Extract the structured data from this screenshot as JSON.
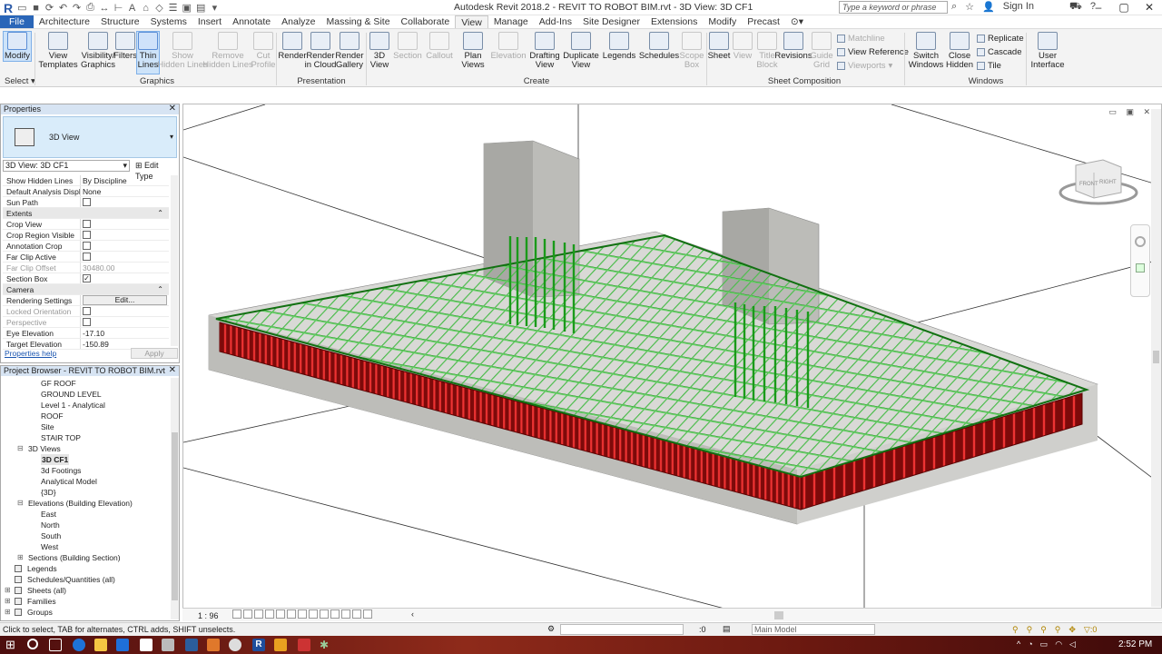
{
  "titlebar": {
    "logo": "R",
    "title": "Autodesk Revit 2018.2 -    REVIT TO ROBOT BIM.rvt - 3D View: 3D CF1",
    "search_placeholder": "Type a keyword or phrase",
    "sign_in": "Sign In"
  },
  "tabs": [
    "File",
    "Architecture",
    "Structure",
    "Systems",
    "Insert",
    "Annotate",
    "Analyze",
    "Massing & Site",
    "Collaborate",
    "View",
    "Manage",
    "Add-Ins",
    "Site Designer",
    "Extensions",
    "Modify",
    "Precast"
  ],
  "active_tab": "View",
  "ribbon": {
    "modify": "Modify",
    "select": "Select",
    "graphics": [
      "View\nTemplates",
      "Visibility/\nGraphics",
      "Filters",
      "Thin\nLines",
      "Show\nHidden Lines",
      "Remove\nHidden Lines",
      "Cut\nProfile"
    ],
    "graphics_label": "Graphics",
    "presentation": [
      "Render",
      "Render\nin Cloud",
      "Render\nGallery"
    ],
    "presentation_label": "Presentation",
    "create": [
      "3D\nView",
      "Section",
      "Callout",
      "Plan\nViews",
      "Elevation",
      "Drafting\nView",
      "Duplicate\nView",
      "Legends",
      "Schedules",
      "Scope\nBox"
    ],
    "create_label": "Create",
    "sheet": [
      "Sheet",
      "View",
      "Title\nBlock",
      "Revisions",
      "Guide\nGrid"
    ],
    "sheet_small": [
      "Matchline",
      "View Reference",
      "Viewports"
    ],
    "sheet_label": "Sheet Composition",
    "windows": [
      "Switch\nWindows",
      "Close\nHidden"
    ],
    "windows_small": [
      "Replicate",
      "Cascade",
      "Tile"
    ],
    "windows_label": "Windows",
    "user_interface": "User\nInterface"
  },
  "properties": {
    "title": "Properties",
    "type_name": "3D View",
    "instance": "3D View: 3D CF1",
    "edit_type": "Edit Type",
    "rows": [
      {
        "k": "Show Hidden Lines",
        "v": "By Discipline"
      },
      {
        "k": "Default Analysis Displ...",
        "v": "None"
      },
      {
        "k": "Sun Path",
        "chk": false
      },
      {
        "section": "Extents"
      },
      {
        "k": "Crop View",
        "chk": false
      },
      {
        "k": "Crop Region Visible",
        "chk": false
      },
      {
        "k": "Annotation Crop",
        "chk": false
      },
      {
        "k": "Far Clip Active",
        "chk": false
      },
      {
        "k": "Far Clip Offset",
        "v": "30480.00",
        "dis": true
      },
      {
        "k": "Section Box",
        "chk": true
      },
      {
        "section": "Camera"
      },
      {
        "k": "Rendering Settings",
        "btn": "Edit..."
      },
      {
        "k": "Locked Orientation",
        "chk": false,
        "dis": true
      },
      {
        "k": "Perspective",
        "chk": false,
        "dis": true
      },
      {
        "k": "Eye Elevation",
        "v": "-17.10"
      },
      {
        "k": "Target Elevation",
        "v": "-150.89"
      }
    ],
    "help": "Properties help",
    "apply": "Apply"
  },
  "browser": {
    "title": "Project Browser - REVIT TO ROBOT BIM.rvt",
    "nodes": [
      {
        "t": "GF ROOF",
        "l": 3
      },
      {
        "t": "GROUND LEVEL",
        "l": 3
      },
      {
        "t": "Level 1 - Analytical",
        "l": 3
      },
      {
        "t": "ROOF",
        "l": 3
      },
      {
        "t": "Site",
        "l": 3
      },
      {
        "t": "STAIR TOP",
        "l": 3
      },
      {
        "t": "3D Views",
        "l": 1,
        "tg": "⊟"
      },
      {
        "t": "3D CF1",
        "l": 3,
        "b": true
      },
      {
        "t": "3d Footings",
        "l": 3
      },
      {
        "t": "Analytical Model",
        "l": 3
      },
      {
        "t": "{3D}",
        "l": 3
      },
      {
        "t": "Elevations (Building Elevation)",
        "l": 1,
        "tg": "⊟"
      },
      {
        "t": "East",
        "l": 3
      },
      {
        "t": "North",
        "l": 3
      },
      {
        "t": "South",
        "l": 3
      },
      {
        "t": "West",
        "l": 3
      },
      {
        "t": "Sections (Building Section)",
        "l": 1,
        "tg": "⊞"
      },
      {
        "t": "Legends",
        "l": 0,
        "ic": true
      },
      {
        "t": "Schedules/Quantities (all)",
        "l": 0,
        "ic": true
      },
      {
        "t": "Sheets (all)",
        "l": 0,
        "ic": true,
        "tg": "⊞"
      },
      {
        "t": "Families",
        "l": 0,
        "ic": true,
        "tg": "⊞"
      },
      {
        "t": "Groups",
        "l": 0,
        "ic": true,
        "tg": "⊞"
      }
    ]
  },
  "viewcube": {
    "front": "FRONT",
    "right": "RIGHT"
  },
  "view_control": {
    "scale": "1 : 96"
  },
  "status": {
    "message": "Click to select, TAB for alternates, CTRL adds, SHIFT unselects.",
    "z": ":0",
    "model": "Main Model",
    "filter": ":0"
  },
  "taskbar": {
    "time": "2:52 PM"
  },
  "colors": {
    "file_tab": "#2a66b8",
    "top_rebar": "#2faa2f",
    "bottom_rebar": "#c81414",
    "concrete": "#c9c9c6"
  }
}
